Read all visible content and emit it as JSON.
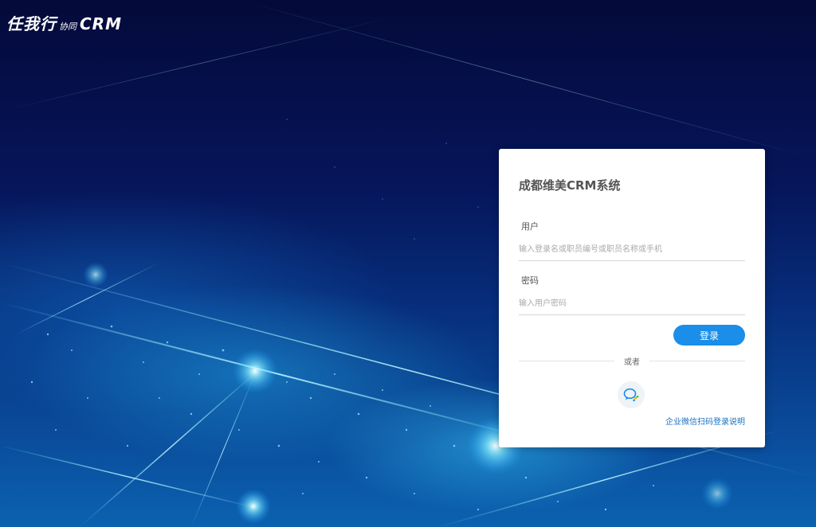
{
  "logo": {
    "main": "任我行",
    "sub": "协同",
    "crm": "CRM"
  },
  "login": {
    "title": "成都维美CRM系统",
    "user_label": "用户",
    "user_placeholder": "输入登录名或职员编号或职员名称或手机",
    "password_label": "密码",
    "password_placeholder": "输入用户密码",
    "submit_label": "登录",
    "divider_text": "或者",
    "wechat_icon": "wechat-work-icon",
    "help_link": "企业微信扫码登录说明"
  },
  "colors": {
    "accent": "#1a8ee8",
    "link": "#1a6fc2",
    "background_dark": "#040a3a",
    "background_light": "#0b62b0"
  }
}
